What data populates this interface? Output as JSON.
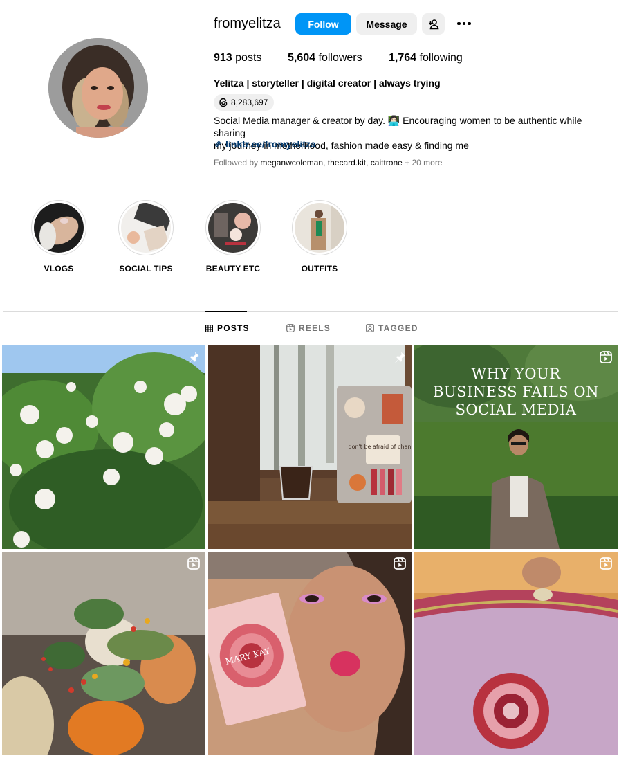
{
  "profile": {
    "username": "fromyelitza",
    "follow_label": "Follow",
    "message_label": "Message",
    "posts_count": "913",
    "posts_label": " posts",
    "followers_count": "5,604",
    "followers_label": " followers",
    "following_count": "1,764",
    "following_label": " following",
    "full_name": "Yelitza | storyteller | digital creator | always trying",
    "threads_count": "8,283,697",
    "bio_line1": "Social Media manager & creator by day. 👩🏻‍💻 Encouraging women to be authentic while sharing",
    "bio_line2": "my journey in motherhood, fashion made easy & finding me",
    "link": "linktr.ee/fromyelitza",
    "followed_by_prefix": "Followed by ",
    "followed_by_user1": "meganwcoleman",
    "sep1": ", ",
    "followed_by_user2": "thecard.kit",
    "sep2": ", ",
    "followed_by_user3": "caittrone",
    "followed_by_more": " + 20 more"
  },
  "highlights": [
    {
      "label": "VLOGS"
    },
    {
      "label": "SOCIAL TIPS"
    },
    {
      "label": "BEAUTY ETC"
    },
    {
      "label": "OUTFITS"
    }
  ],
  "tabs": [
    {
      "label": "POSTS",
      "active": true
    },
    {
      "label": "REELS",
      "active": false
    },
    {
      "label": "TAGGED",
      "active": false
    }
  ],
  "posts": [
    {
      "badge": "pin-icon"
    },
    {
      "badge": "pin-icon",
      "sticker_text": "don't be afraid of change"
    },
    {
      "badge": "reel-icon",
      "overlay_line1": "WHY YOUR",
      "overlay_line2": "BUSINESS FAILS ON",
      "overlay_line3": "SOCIAL MEDIA"
    },
    {
      "badge": "reel-icon"
    },
    {
      "badge": "reel-icon",
      "product_text": "MARY KAY"
    },
    {
      "badge": "reel-icon"
    }
  ],
  "colors": {
    "follow_button": "#0095f6",
    "secondary_button": "#efefef",
    "link": "#00376b",
    "muted_text": "#737373",
    "divider": "#dbdbdb"
  }
}
